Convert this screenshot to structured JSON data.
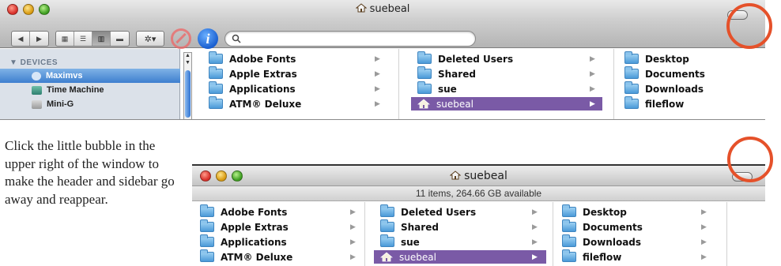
{
  "window_top": {
    "title": "suebeal",
    "search": {
      "placeholder": ""
    },
    "toolbar": {
      "nav": [
        "◀",
        "▶"
      ],
      "views": [
        "▦",
        "☰",
        "▥",
        "▬"
      ],
      "action_label": "✲▾",
      "info_label": "i"
    },
    "sidebar": {
      "header": "▼ DEVICES",
      "items": [
        {
          "label": "Maximvs",
          "selected": true
        },
        {
          "label": "Time Machine",
          "selected": false
        },
        {
          "label": "Mini-G",
          "selected": false
        }
      ]
    },
    "columns": [
      [
        "Adobe Fonts",
        "Apple Extras",
        "Applications",
        "ATM® Deluxe"
      ],
      [
        "Deleted Users",
        "Shared",
        "sue",
        "suebeal"
      ],
      [
        "Desktop",
        "Documents",
        "Downloads",
        "fileflow"
      ]
    ]
  },
  "window_bottom": {
    "title": "suebeal",
    "status": "11 items, 264.66 GB available",
    "columns": [
      [
        "Adobe Fonts",
        "Apple Extras",
        "Applications",
        "ATM® Deluxe"
      ],
      [
        "Deleted Users",
        "Shared",
        "sue",
        "suebeal"
      ],
      [
        "Desktop",
        "Documents",
        "Downloads",
        "fileflow"
      ]
    ]
  },
  "caption": "Click the little bubble in the upper right of the window to make the header and sidebar go away and reappear.",
  "colors": {
    "highlight_ring": "#e5512a",
    "selection_purple": "#7a5aa6",
    "sidebar_selection": "#3e7fcf"
  }
}
